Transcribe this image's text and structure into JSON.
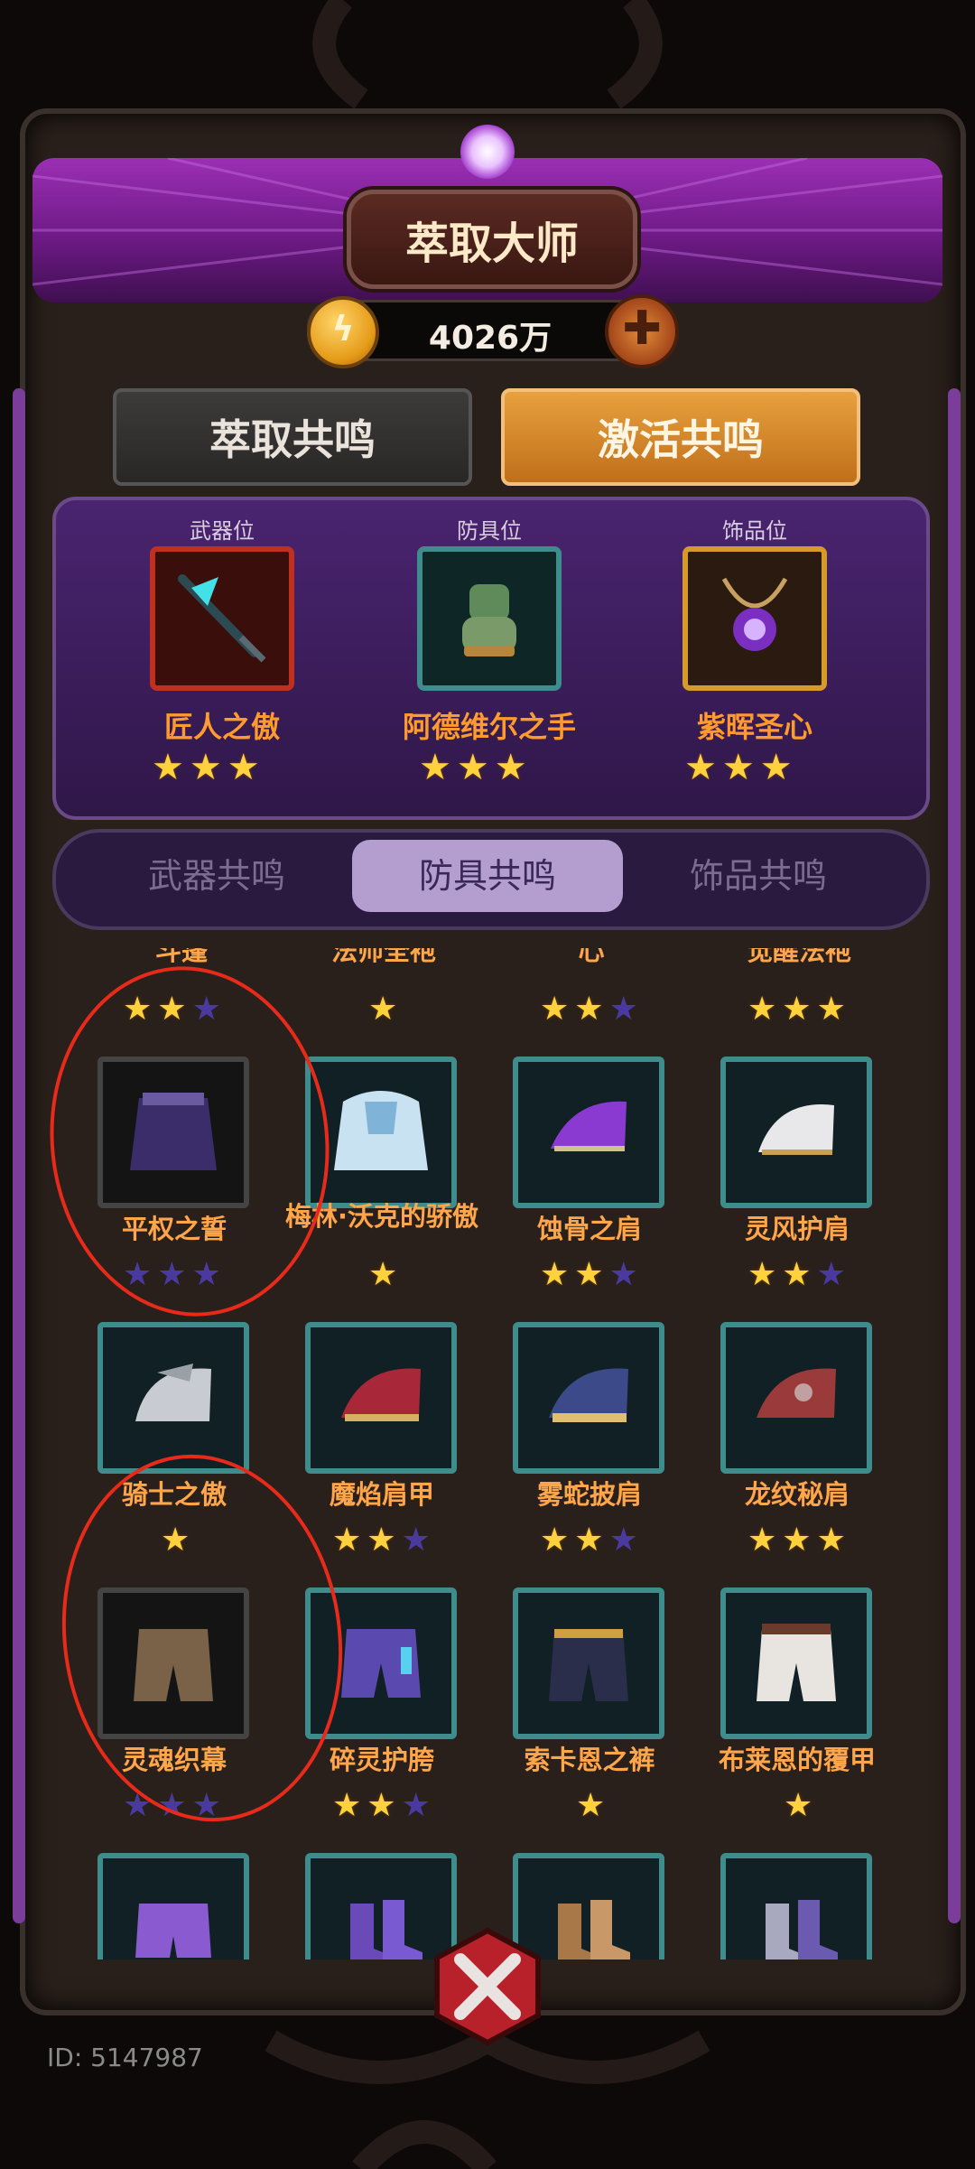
{
  "title": "萃取大师",
  "currency": {
    "amount": "4026万",
    "coin_icon": "lightning-coin-icon",
    "add_icon": "plus-icon"
  },
  "main_tabs": [
    {
      "label": "萃取共鸣",
      "active": false
    },
    {
      "label": "激活共鸣",
      "active": true
    }
  ],
  "slots": [
    {
      "position_label": "武器位",
      "item_name": "匠人之傲",
      "stars": 3,
      "frame_color": "#c0301f",
      "icon": "spear-icon"
    },
    {
      "position_label": "防具位",
      "item_name": "阿德维尔之手",
      "stars": 3,
      "frame_color": "#3f8c8c",
      "icon": "gauntlet-icon"
    },
    {
      "position_label": "饰品位",
      "item_name": "紫晖圣心",
      "stars": 3,
      "frame_color": "#d49a2a",
      "icon": "amulet-icon"
    }
  ],
  "sub_tabs": [
    {
      "label": "武器共鸣",
      "active": false
    },
    {
      "label": "防具共鸣",
      "active": true
    },
    {
      "label": "饰品共鸣",
      "active": false
    }
  ],
  "partial_row": [
    {
      "name": "斗篷",
      "stars": 2,
      "max": 3
    },
    {
      "name": "法师全袍",
      "stars": 1,
      "max": 1
    },
    {
      "name": "心",
      "stars": 2,
      "max": 3
    },
    {
      "name": "觉醒法袍",
      "stars": 3,
      "max": 3
    }
  ],
  "items": [
    {
      "name": "平权之誓",
      "stars": 0,
      "max": 3,
      "dim": true,
      "icon": "cape-icon"
    },
    {
      "name": "梅林·沃克的骄傲",
      "stars": 1,
      "max": 1,
      "dim": false,
      "icon": "mantle-icon"
    },
    {
      "name": "蚀骨之肩",
      "stars": 2,
      "max": 3,
      "dim": false,
      "icon": "purple-pauldron-icon"
    },
    {
      "name": "灵风护肩",
      "stars": 2,
      "max": 3,
      "dim": false,
      "icon": "white-pauldron-icon"
    },
    {
      "name": "骑士之傲",
      "stars": 1,
      "max": 1,
      "dim": false,
      "icon": "silver-pauldron-icon"
    },
    {
      "name": "魔焰肩甲",
      "stars": 2,
      "max": 3,
      "dim": false,
      "icon": "red-pauldron-icon"
    },
    {
      "name": "雾蛇披肩",
      "stars": 2,
      "max": 3,
      "dim": false,
      "icon": "blue-pauldron-icon"
    },
    {
      "name": "龙纹秘肩",
      "stars": 3,
      "max": 3,
      "dim": false,
      "icon": "crimson-pauldron-icon"
    },
    {
      "name": "灵魂织幕",
      "stars": 0,
      "max": 3,
      "dim": true,
      "icon": "brown-pants-icon"
    },
    {
      "name": "碎灵护胯",
      "stars": 2,
      "max": 3,
      "dim": false,
      "icon": "purple-pants-icon"
    },
    {
      "name": "索卡恩之裤",
      "stars": 1,
      "max": 1,
      "dim": false,
      "icon": "navy-pants-icon"
    },
    {
      "name": "布莱恩的覆甲",
      "stars": 1,
      "max": 1,
      "dim": false,
      "icon": "white-pants-icon"
    }
  ],
  "bottom_row_icons": [
    "purple-shorts-icon",
    "purple-boots-icon",
    "brown-boots-icon",
    "silver-boots-icon"
  ],
  "close_icon": "close-x-icon",
  "player_id": "ID: 5147987"
}
